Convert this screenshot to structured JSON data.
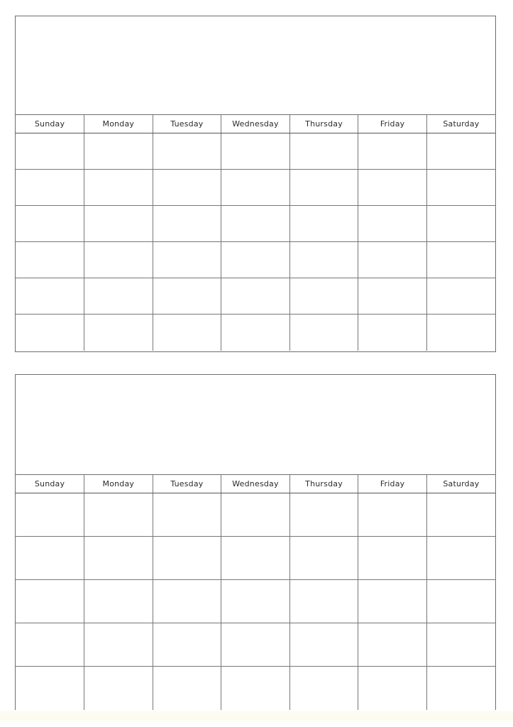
{
  "document": {
    "kind": "blank-monthly-calendar-template",
    "page_background": "#ffffff",
    "border_color": "#6e6e6e",
    "grid_line_color": "#777777",
    "text_color": "#2b2b2b",
    "calendar_count": 2
  },
  "calendars": [
    {
      "id": "calendar-1",
      "title": "",
      "weekday_headers": [
        "Sunday",
        "Monday",
        "Tuesday",
        "Wednesday",
        "Thursday",
        "Friday",
        "Saturday"
      ],
      "week_count": 6,
      "weeks": [
        [
          "",
          "",
          "",
          "",
          "",
          "",
          ""
        ],
        [
          "",
          "",
          "",
          "",
          "",
          "",
          ""
        ],
        [
          "",
          "",
          "",
          "",
          "",
          "",
          ""
        ],
        [
          "",
          "",
          "",
          "",
          "",
          "",
          ""
        ],
        [
          "",
          "",
          "",
          "",
          "",
          "",
          ""
        ],
        [
          "",
          "",
          "",
          "",
          "",
          "",
          ""
        ]
      ]
    },
    {
      "id": "calendar-2",
      "title": "",
      "weekday_headers": [
        "Sunday",
        "Monday",
        "Tuesday",
        "Wednesday",
        "Thursday",
        "Friday",
        "Saturday"
      ],
      "week_count": 5,
      "weeks": [
        [
          "",
          "",
          "",
          "",
          "",
          "",
          ""
        ],
        [
          "",
          "",
          "",
          "",
          "",
          "",
          ""
        ],
        [
          "",
          "",
          "",
          "",
          "",
          "",
          ""
        ],
        [
          "",
          "",
          "",
          "",
          "",
          "",
          ""
        ],
        [
          "",
          "",
          "",
          "",
          "",
          "",
          ""
        ]
      ]
    }
  ]
}
